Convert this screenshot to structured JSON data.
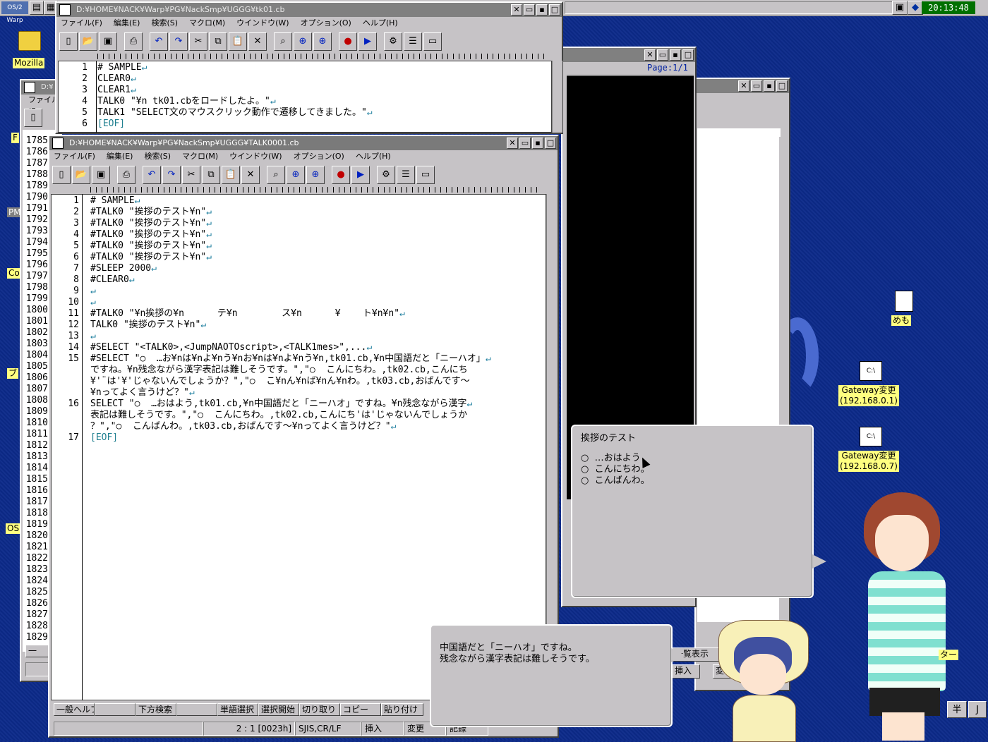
{
  "taskbar": {
    "clock": "20:13:48",
    "logo": "OS/2 Warp"
  },
  "desktop_icons": {
    "mozilla": "Mozilla",
    "memo": "めも",
    "gateway1": "Gateway変更\n(192.168.0.1)",
    "gateway2": "Gateway変更\n(192.168.0.7)",
    "cmd_label": "C:\\",
    "left_f": "F",
    "left_pm": "PM",
    "left_co": "Co",
    "left_bu": "ブ",
    "left_os": "OS"
  },
  "win_top": {
    "title": "D:¥HOME¥NACK¥Warp¥PG¥NackSmp¥UGGG¥tk01.cb",
    "menu": [
      "ファイル(F)",
      "編集(E)",
      "検索(S)",
      "マクロ(M)",
      "ウインドウ(W)",
      "オプション(O)",
      "ヘルプ(H)"
    ],
    "lines": [
      {
        "n": "1",
        "t": "# SAMPLE"
      },
      {
        "n": "2",
        "t": "CLEAR0"
      },
      {
        "n": "3",
        "t": "CLEAR1"
      },
      {
        "n": "4",
        "t": "TALK0 \"¥n tk01.cbをロードしたよ。\""
      },
      {
        "n": "5",
        "t": "TALK1 \"SELECT文のマウスクリック動作で遷移してきました。\""
      },
      {
        "n": "6",
        "t": "[EOF]"
      }
    ]
  },
  "win_main": {
    "title": "D:¥HOME¥NACK¥Warp¥PG¥NackSmp¥UGGG¥TALK0001.cb",
    "menu": [
      "ファイル(F)",
      "編集(E)",
      "検索(S)",
      "マクロ(M)",
      "ウインドウ(W)",
      "オプション(O)",
      "ヘルプ(H)"
    ],
    "lines": [
      {
        "n": "1",
        "t": "# SAMPLE"
      },
      {
        "n": "2",
        "t": "#TALK0 \"挨拶のテスト¥n\""
      },
      {
        "n": "3",
        "t": "#TALK0 \"挨拶のテスト¥n\""
      },
      {
        "n": "4",
        "t": "#TALK0 \"挨拶のテスト¥n\""
      },
      {
        "n": "5",
        "t": "#TALK0 \"挨拶のテスト¥n\""
      },
      {
        "n": "6",
        "t": "#TALK0 \"挨拶のテスト¥n\""
      },
      {
        "n": "7",
        "t": "#SLEEP 2000"
      },
      {
        "n": "8",
        "t": "#CLEAR0"
      },
      {
        "n": "9",
        "t": ""
      },
      {
        "n": "10",
        "t": ""
      },
      {
        "n": "11",
        "t": "#TALK0 \"¥n挨拶の¥n      テ¥n        ス¥n      ¥    ト¥n¥n\""
      },
      {
        "n": "12",
        "t": "TALK0 \"挨拶のテスト¥n\""
      },
      {
        "n": "13",
        "t": ""
      },
      {
        "n": "14",
        "t": "#SELECT \"<TALK0>,<JumpNAOTOscript>,<TALK1mes>\",..."
      },
      {
        "n": "15",
        "t": "#SELECT \"○  …お¥nは¥nよ¥nう¥nお¥nは¥nよ¥nう¥n,tk01.cb,¥n中国語だと「ニーハオ」"
      },
      {
        "n": "",
        "t": "ですね。¥n残念ながら漢字表記は難しそうです。\",\"○  こんにちわ。,tk02.cb,こんにち"
      },
      {
        "n": "",
        "t": "¥'¨は'¥'じゃないんでしょうか？\",\"○  こ¥nん¥nば¥nん¥nわ。,tk03.cb,おばんです～"
      },
      {
        "n": "",
        "t": "¥nってよく言うけど？\""
      },
      {
        "n": "16",
        "t": "SELECT \"○  …おはよう,tk01.cb,¥n中国語だと「ニーハオ」ですね。¥n残念ながら漢字"
      },
      {
        "n": "",
        "t": "表記は難しそうです。\",\"○  こんにちわ。,tk02.cb,こんにち'は'じゃないんでしょうか"
      },
      {
        "n": "",
        "t": "？\",\"○  こんばんわ。,tk03.cb,おばんです～¥nってよく言うけど？\""
      },
      {
        "n": "17",
        "t": "[EOF]"
      }
    ],
    "fkeys": [
      "一般ヘルプ",
      "",
      "下方検索",
      "",
      "単語選択",
      "選択開始",
      "切り取り",
      "コピー",
      "貼り付け"
    ],
    "status": {
      "pos": "2 : 1 [0023h]",
      "enc": "SJIS,CR/LF",
      "mode": "挿入",
      "changed": "変更",
      "rec": "記録"
    }
  },
  "behind_lines": [
    "1785",
    "1786",
    "1787",
    "1788",
    "1789",
    "1790",
    "1791",
    "1792",
    "1793",
    "1794",
    "1795",
    "1796",
    "1797",
    "1798",
    "1799",
    "1800",
    "1801",
    "1802",
    "1803",
    "1804",
    "1805",
    "1806",
    "1807",
    "1808",
    "1809",
    "1810",
    "1811",
    "1812",
    "1813",
    "1814",
    "1815",
    "1816",
    "1817",
    "1818",
    "1819",
    "1820",
    "1821",
    "1822",
    "1823",
    "1824",
    "1825",
    "1826",
    "1827",
    "1828",
    "1829"
  ],
  "behind_left": {
    "title": "D:¥",
    "menu": "ファイル(F"
  },
  "preview_win": {
    "page": "Page:1/1"
  },
  "right_win": {
    "list_btn": "一覧表示",
    "insert_btn": "挿入",
    "change_btn": "変"
  },
  "select_balloon": {
    "title": "挨拶のテスト",
    "options": [
      "○  …おはよう",
      "○  こんにちわ。",
      "○  こんばんわ。"
    ]
  },
  "talk_balloon": {
    "line1": "中国語だと「ニーハオ」ですね。",
    "line2": "残念ながら漢字表記は難しそうです。"
  },
  "right_labels": {
    "ta": "ター",
    "han": "半",
    "j": "J"
  }
}
